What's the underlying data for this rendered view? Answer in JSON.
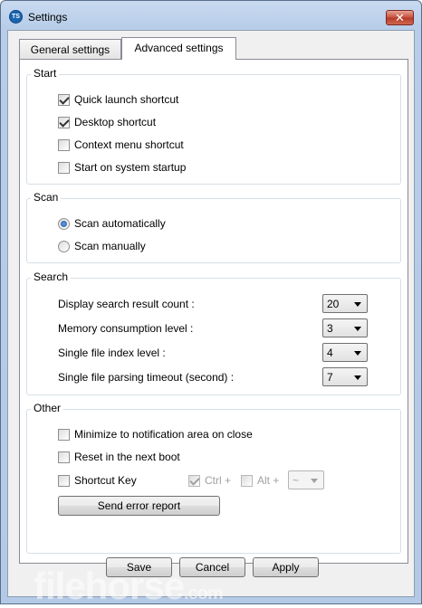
{
  "window": {
    "title": "Settings",
    "close_glyph": "✕",
    "icon_text": "TS"
  },
  "tabs": [
    {
      "label": "General settings"
    },
    {
      "label": "Advanced settings"
    }
  ],
  "start": {
    "title": "Start",
    "items": [
      {
        "label": "Quick launch shortcut",
        "checked": true
      },
      {
        "label": "Desktop shortcut",
        "checked": true
      },
      {
        "label": "Context menu shortcut",
        "checked": false
      },
      {
        "label": "Start on system startup",
        "checked": false
      }
    ]
  },
  "scan": {
    "title": "Scan",
    "options": [
      {
        "label": "Scan automatically",
        "selected": true
      },
      {
        "label": "Scan manually",
        "selected": false
      }
    ]
  },
  "search": {
    "title": "Search",
    "rows": [
      {
        "label": "Display search result count :",
        "value": "20"
      },
      {
        "label": "Memory consumption level :",
        "value": "3"
      },
      {
        "label": "Single file index level :",
        "value": "4"
      },
      {
        "label": "Single file parsing timeout (second) :",
        "value": "7"
      }
    ]
  },
  "other": {
    "title": "Other",
    "minimize_label": "Minimize to notification area on close",
    "reset_label": "Reset in the next boot",
    "shortcut_label": "Shortcut Key",
    "ctrl_label": "Ctrl +",
    "alt_label": "Alt +",
    "key_value": "~",
    "send_error_label": "Send error report"
  },
  "footer": {
    "save_label": "Save",
    "cancel_label": "Cancel",
    "apply_label": "Apply"
  },
  "watermark": {
    "text": "filehorse",
    "suffix": ".com"
  }
}
